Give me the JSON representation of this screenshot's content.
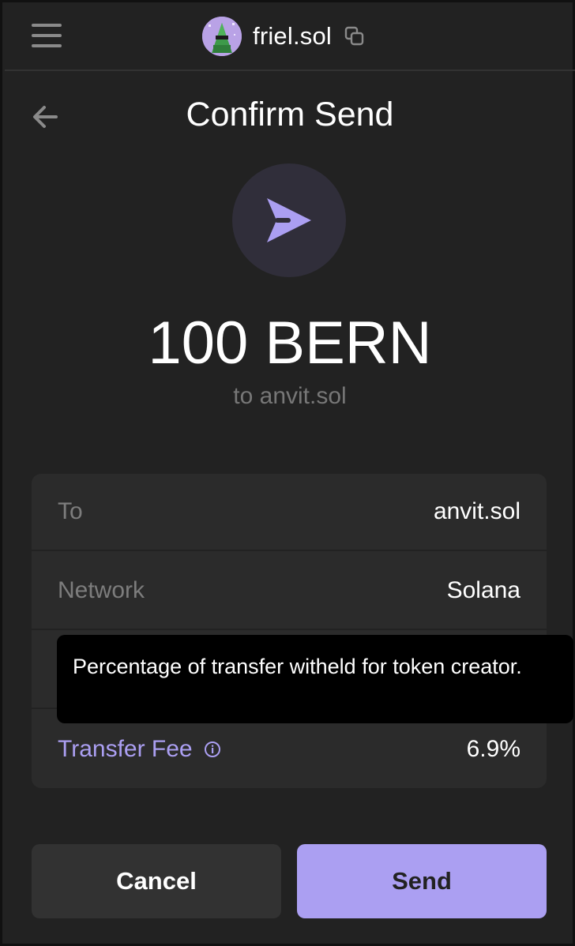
{
  "header": {
    "account_name": "friel.sol",
    "menu_icon": "hamburger-menu-icon",
    "copy_icon": "copy-icon"
  },
  "page": {
    "title": "Confirm Send",
    "back_icon": "arrow-left-icon",
    "send_icon": "paper-plane-icon"
  },
  "transfer": {
    "amount": "100 BERN",
    "to_line": "to anvit.sol"
  },
  "details": [
    {
      "label": "To",
      "value": "anvit.sol"
    },
    {
      "label": "Network",
      "value": "Solana"
    },
    {
      "label": "",
      "value": ""
    },
    {
      "label": "Transfer Fee",
      "value": "6.9%"
    }
  ],
  "tooltip": {
    "text": "Percentage of transfer witheld for token creator."
  },
  "buttons": {
    "cancel_label": "Cancel",
    "send_label": "Send"
  },
  "colors": {
    "background": "#222222",
    "accent": "#ab9ff2",
    "card": "#2b2b2b"
  }
}
